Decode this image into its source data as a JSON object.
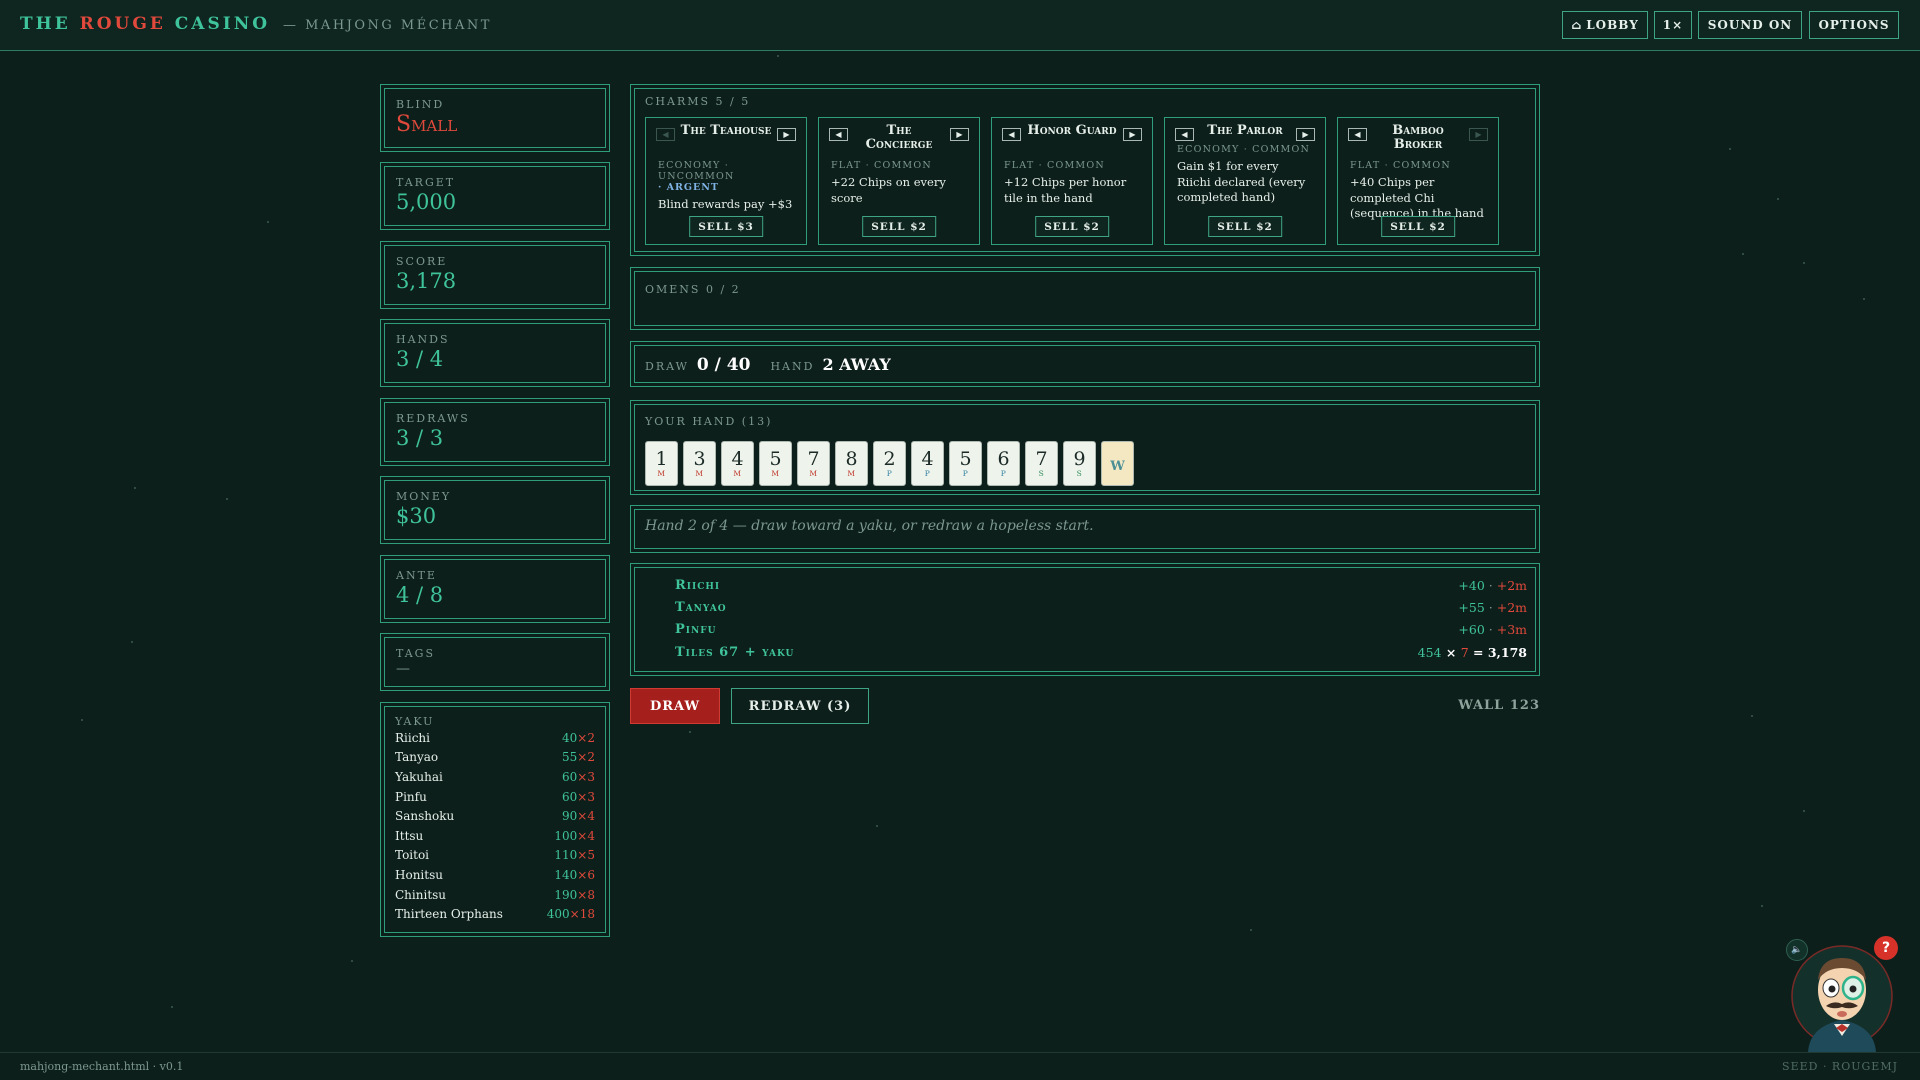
{
  "header": {
    "brand_the": "THE",
    "brand_rouge": "ROUGE",
    "brand_casino": "CASINO",
    "brand_sub": "— MAHJONG MÉCHANT",
    "buttons": {
      "lobby_icon": "⌂",
      "lobby": "LOBBY",
      "speed": "1×",
      "sound": "SOUND ON",
      "options": "OPTIONS"
    }
  },
  "stats": {
    "blind": {
      "label": "BLIND",
      "value": "Small"
    },
    "target": {
      "label": "TARGET",
      "value": "5,000"
    },
    "score": {
      "label": "SCORE",
      "value": "3,178"
    },
    "hands": {
      "label": "HANDS",
      "value": "3 / 4"
    },
    "redraws": {
      "label": "REDRAWS",
      "value": "3 / 3"
    },
    "money": {
      "label": "MONEY",
      "value": "$30"
    },
    "ante": {
      "label": "ANTE",
      "value": "4 / 8"
    },
    "tags": {
      "label": "TAGS",
      "value": "—"
    }
  },
  "yaku_table": {
    "label": "YAKU",
    "rows": [
      {
        "name": "Riichi",
        "chips": "40",
        "mult": "2"
      },
      {
        "name": "Tanyao",
        "chips": "55",
        "mult": "2"
      },
      {
        "name": "Yakuhai",
        "chips": "60",
        "mult": "3"
      },
      {
        "name": "Pinfu",
        "chips": "60",
        "mult": "3"
      },
      {
        "name": "Sanshoku",
        "chips": "90",
        "mult": "4"
      },
      {
        "name": "Ittsu",
        "chips": "100",
        "mult": "4"
      },
      {
        "name": "Toitoi",
        "chips": "110",
        "mult": "5"
      },
      {
        "name": "Honitsu",
        "chips": "140",
        "mult": "6"
      },
      {
        "name": "Chinitsu",
        "chips": "190",
        "mult": "8"
      },
      {
        "name": "Thirteen Orphans",
        "chips": "400",
        "mult": "18"
      }
    ]
  },
  "charms": {
    "label": "CHARMS 5 / 5",
    "items": [
      {
        "name": "The Teahouse",
        "meta": "ECONOMY · UNCOMMON",
        "edition": "· ARGENT",
        "desc": "Blind rewards pay +$3",
        "sell": "SELL $3"
      },
      {
        "name": "The Concierge",
        "meta": "FLAT · COMMON",
        "edition": "",
        "desc": "+22 Chips on every score",
        "sell": "SELL $2"
      },
      {
        "name": "Honor Guard",
        "meta": "FLAT · COMMON",
        "edition": "",
        "desc": "+12 Chips per honor tile in the hand",
        "sell": "SELL $2"
      },
      {
        "name": "The Parlor",
        "meta": "ECONOMY · COMMON",
        "edition": "",
        "desc": "Gain $1 for every Riichi declared (every completed hand)",
        "sell": "SELL $2"
      },
      {
        "name": "Bamboo Broker",
        "meta": "FLAT · COMMON",
        "edition": "",
        "desc": "+40 Chips per completed Chi (sequence) in the hand",
        "sell": "SELL $2"
      }
    ]
  },
  "omens": {
    "label": "OMENS 0 / 2"
  },
  "progress": {
    "draw_label": "DRAW",
    "draw_value": "0 / 40",
    "hand_label": "HAND",
    "hand_value": "2 AWAY"
  },
  "hand": {
    "label": "YOUR HAND (13)",
    "tiles": [
      {
        "n": "1",
        "s": "M",
        "color": "#c0392b"
      },
      {
        "n": "3",
        "s": "M",
        "color": "#c0392b"
      },
      {
        "n": "4",
        "s": "M",
        "color": "#c0392b"
      },
      {
        "n": "5",
        "s": "M",
        "color": "#c0392b"
      },
      {
        "n": "7",
        "s": "M",
        "color": "#c0392b"
      },
      {
        "n": "8",
        "s": "M",
        "color": "#c0392b"
      },
      {
        "n": "2",
        "s": "P",
        "color": "#2e7fa0"
      },
      {
        "n": "4",
        "s": "P",
        "color": "#2e7fa0"
      },
      {
        "n": "5",
        "s": "P",
        "color": "#2e7fa0"
      },
      {
        "n": "6",
        "s": "P",
        "color": "#2e7fa0"
      },
      {
        "n": "7",
        "s": "S",
        "color": "#2e8b57"
      },
      {
        "n": "9",
        "s": "S",
        "color": "#2e8b57"
      },
      {
        "n": "W",
        "s": "",
        "color": "#4b8f96",
        "honor": true
      }
    ]
  },
  "message": "Hand 2 of 4 — draw toward a yaku, or redraw a hopeless start.",
  "scoring": {
    "rows": [
      {
        "name": "Riichi",
        "chips": "+40",
        "mult": "+2m"
      },
      {
        "name": "Tanyao",
        "chips": "+55",
        "mult": "+2m"
      },
      {
        "name": "Pinfu",
        "chips": "+60",
        "mult": "+3m"
      }
    ],
    "total": {
      "name": "Tiles 67 + yaku",
      "chips": "454",
      "times": "×",
      "mult": "7",
      "eq": "=",
      "result": "3,178"
    }
  },
  "actions": {
    "draw": "DRAW",
    "redraw": "REDRAW (3)",
    "wall": "WALL 123"
  },
  "footer": {
    "version": "mahjong-mechant.html · v0.1",
    "seed": "SEED · ROUGEMJ"
  },
  "mascot": {
    "help": "?",
    "sound_icon": "🔈"
  }
}
